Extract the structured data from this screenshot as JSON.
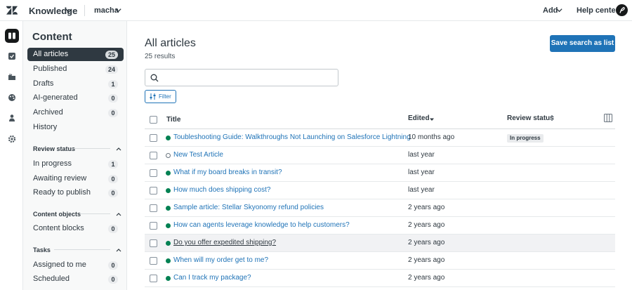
{
  "topbar": {
    "product": "Knowledge",
    "brand": "macha",
    "add_label": "Add",
    "help_label": "Help center"
  },
  "rail": {
    "icons": [
      "knowledge-icon",
      "review-icon",
      "folders-icon",
      "palette-icon",
      "people-icon",
      "settings-icon"
    ]
  },
  "sidebar": {
    "title": "Content",
    "items": [
      {
        "label": "All articles",
        "count": "25"
      },
      {
        "label": "Published",
        "count": "24"
      },
      {
        "label": "Drafts",
        "count": "1"
      },
      {
        "label": "AI-generated",
        "count": "0"
      },
      {
        "label": "Archived",
        "count": "0"
      },
      {
        "label": "History",
        "count": ""
      }
    ],
    "review_status": {
      "heading": "Review status",
      "items": [
        {
          "label": "In progress",
          "count": "1"
        },
        {
          "label": "Awaiting review",
          "count": "0"
        },
        {
          "label": "Ready to publish",
          "count": "0"
        }
      ]
    },
    "content_objects": {
      "heading": "Content objects",
      "items": [
        {
          "label": "Content blocks",
          "count": "0"
        }
      ]
    },
    "tasks": {
      "heading": "Tasks",
      "items": [
        {
          "label": "Assigned to me",
          "count": "0"
        },
        {
          "label": "Scheduled",
          "count": "0"
        }
      ]
    }
  },
  "main": {
    "title": "All articles",
    "results": "25 results",
    "save_button": "Save search as list",
    "search_placeholder": "",
    "filter_label": "Filter",
    "columns": {
      "title": "Title",
      "edited": "Edited",
      "review_status": "Review status"
    },
    "rows": [
      {
        "title": "Toubleshooting Guide: Walkthroughs Not Launching on Salesforce Lightning",
        "edited": "10 months ago",
        "status": "In progress",
        "state": "published"
      },
      {
        "title": "New Test Article",
        "edited": "last year",
        "status": "",
        "state": "draft"
      },
      {
        "title": "What if my board breaks in transit?",
        "edited": "last year",
        "status": "",
        "state": "published"
      },
      {
        "title": "How much does shipping cost?",
        "edited": "last year",
        "status": "",
        "state": "published"
      },
      {
        "title": "Sample article: Stellar Skyonomy refund policies",
        "edited": "2 years ago",
        "status": "",
        "state": "published"
      },
      {
        "title": "How can agents leverage knowledge to help customers?",
        "edited": "2 years ago",
        "status": "",
        "state": "published"
      },
      {
        "title": "Do you offer expedited shipping?",
        "edited": "2 years ago",
        "status": "",
        "state": "published"
      },
      {
        "title": "When will my order get to me?",
        "edited": "2 years ago",
        "status": "",
        "state": "published"
      },
      {
        "title": "Can I track my package?",
        "edited": "2 years ago",
        "status": "",
        "state": "published"
      }
    ]
  },
  "colors": {
    "accent": "#1f73b7",
    "published": "#038153",
    "dark": "#2f3941"
  }
}
